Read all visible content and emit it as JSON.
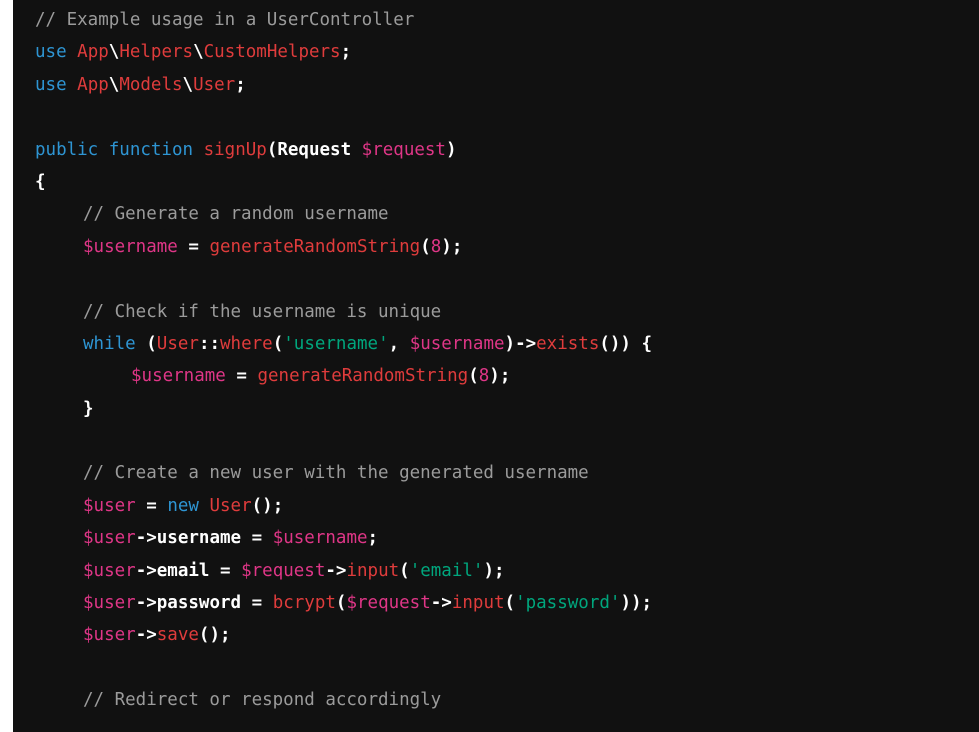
{
  "editor": {
    "language": "php",
    "theme": "dark",
    "background_color": "#111111",
    "gutter_color": "#ffffff",
    "colors": {
      "comment": "#9b9b9b",
      "keyword": "#2e95d3",
      "identifier": "#df3c3c",
      "variable": "#df3687",
      "number": "#df3687",
      "string": "#00a67d",
      "punctuation": "#ffffff",
      "property": "#ffffff"
    },
    "lines": [
      {
        "indent": 0,
        "tokens": [
          {
            "t": "comment",
            "v": "// Example usage in a UserController"
          }
        ]
      },
      {
        "indent": 0,
        "tokens": [
          {
            "t": "keyword",
            "v": "use"
          },
          {
            "t": "plain",
            "v": " "
          },
          {
            "t": "ident",
            "v": "App"
          },
          {
            "t": "punct",
            "v": "\\"
          },
          {
            "t": "ident",
            "v": "Helpers"
          },
          {
            "t": "punct",
            "v": "\\"
          },
          {
            "t": "ident",
            "v": "CustomHelpers"
          },
          {
            "t": "punct",
            "v": ";"
          }
        ]
      },
      {
        "indent": 0,
        "tokens": [
          {
            "t": "keyword",
            "v": "use"
          },
          {
            "t": "plain",
            "v": " "
          },
          {
            "t": "ident",
            "v": "App"
          },
          {
            "t": "punct",
            "v": "\\"
          },
          {
            "t": "ident",
            "v": "Models"
          },
          {
            "t": "punct",
            "v": "\\"
          },
          {
            "t": "ident",
            "v": "User"
          },
          {
            "t": "punct",
            "v": ";"
          }
        ]
      },
      {
        "indent": 0,
        "tokens": []
      },
      {
        "indent": 0,
        "tokens": [
          {
            "t": "keyword",
            "v": "public function"
          },
          {
            "t": "plain",
            "v": " "
          },
          {
            "t": "func",
            "v": "signUp"
          },
          {
            "t": "punct",
            "v": "("
          },
          {
            "t": "bold",
            "v": "Request"
          },
          {
            "t": "plain",
            "v": " "
          },
          {
            "t": "var",
            "v": "$request"
          },
          {
            "t": "punct",
            "v": ")"
          }
        ]
      },
      {
        "indent": 0,
        "tokens": [
          {
            "t": "punct",
            "v": "{"
          }
        ]
      },
      {
        "indent": 1,
        "tokens": [
          {
            "t": "comment",
            "v": "// Generate a random username"
          }
        ]
      },
      {
        "indent": 1,
        "tokens": [
          {
            "t": "var",
            "v": "$username"
          },
          {
            "t": "plain",
            "v": " "
          },
          {
            "t": "punct",
            "v": "="
          },
          {
            "t": "plain",
            "v": " "
          },
          {
            "t": "func",
            "v": "generateRandomString"
          },
          {
            "t": "punct",
            "v": "("
          },
          {
            "t": "number",
            "v": "8"
          },
          {
            "t": "punct",
            "v": ");"
          }
        ]
      },
      {
        "indent": 0,
        "tokens": []
      },
      {
        "indent": 1,
        "tokens": [
          {
            "t": "comment",
            "v": "// Check if the username is unique"
          }
        ]
      },
      {
        "indent": 1,
        "tokens": [
          {
            "t": "keyword",
            "v": "while"
          },
          {
            "t": "plain",
            "v": " "
          },
          {
            "t": "punct",
            "v": "("
          },
          {
            "t": "class",
            "v": "User"
          },
          {
            "t": "punct",
            "v": "::"
          },
          {
            "t": "func",
            "v": "where"
          },
          {
            "t": "punct",
            "v": "("
          },
          {
            "t": "string",
            "v": "'username'"
          },
          {
            "t": "punct",
            "v": ","
          },
          {
            "t": "plain",
            "v": " "
          },
          {
            "t": "var",
            "v": "$username"
          },
          {
            "t": "punct",
            "v": ")->"
          },
          {
            "t": "func",
            "v": "exists"
          },
          {
            "t": "punct",
            "v": "())"
          },
          {
            "t": "plain",
            "v": " "
          },
          {
            "t": "punct",
            "v": "{"
          }
        ]
      },
      {
        "indent": 2,
        "tokens": [
          {
            "t": "var",
            "v": "$username"
          },
          {
            "t": "plain",
            "v": " "
          },
          {
            "t": "punct",
            "v": "="
          },
          {
            "t": "plain",
            "v": " "
          },
          {
            "t": "func",
            "v": "generateRandomString"
          },
          {
            "t": "punct",
            "v": "("
          },
          {
            "t": "number",
            "v": "8"
          },
          {
            "t": "punct",
            "v": ");"
          }
        ]
      },
      {
        "indent": 1,
        "tokens": [
          {
            "t": "punct",
            "v": "}"
          }
        ]
      },
      {
        "indent": 0,
        "tokens": []
      },
      {
        "indent": 1,
        "tokens": [
          {
            "t": "comment",
            "v": "// Create a new user with the generated username"
          }
        ]
      },
      {
        "indent": 1,
        "tokens": [
          {
            "t": "var",
            "v": "$user"
          },
          {
            "t": "plain",
            "v": " "
          },
          {
            "t": "punct",
            "v": "="
          },
          {
            "t": "plain",
            "v": " "
          },
          {
            "t": "keyword",
            "v": "new"
          },
          {
            "t": "plain",
            "v": " "
          },
          {
            "t": "class",
            "v": "User"
          },
          {
            "t": "punct",
            "v": "();"
          }
        ]
      },
      {
        "indent": 1,
        "tokens": [
          {
            "t": "var",
            "v": "$user"
          },
          {
            "t": "punct",
            "v": "->"
          },
          {
            "t": "prop",
            "v": "username"
          },
          {
            "t": "plain",
            "v": " "
          },
          {
            "t": "punct",
            "v": "="
          },
          {
            "t": "plain",
            "v": " "
          },
          {
            "t": "var",
            "v": "$username"
          },
          {
            "t": "punct",
            "v": ";"
          }
        ]
      },
      {
        "indent": 1,
        "tokens": [
          {
            "t": "var",
            "v": "$user"
          },
          {
            "t": "punct",
            "v": "->"
          },
          {
            "t": "prop",
            "v": "email"
          },
          {
            "t": "plain",
            "v": " "
          },
          {
            "t": "punct",
            "v": "="
          },
          {
            "t": "plain",
            "v": " "
          },
          {
            "t": "var",
            "v": "$request"
          },
          {
            "t": "punct",
            "v": "->"
          },
          {
            "t": "func",
            "v": "input"
          },
          {
            "t": "punct",
            "v": "("
          },
          {
            "t": "string",
            "v": "'email'"
          },
          {
            "t": "punct",
            "v": ");"
          }
        ]
      },
      {
        "indent": 1,
        "tokens": [
          {
            "t": "var",
            "v": "$user"
          },
          {
            "t": "punct",
            "v": "->"
          },
          {
            "t": "prop",
            "v": "password"
          },
          {
            "t": "plain",
            "v": " "
          },
          {
            "t": "punct",
            "v": "="
          },
          {
            "t": "plain",
            "v": " "
          },
          {
            "t": "func",
            "v": "bcrypt"
          },
          {
            "t": "punct",
            "v": "("
          },
          {
            "t": "var",
            "v": "$request"
          },
          {
            "t": "punct",
            "v": "->"
          },
          {
            "t": "func",
            "v": "input"
          },
          {
            "t": "punct",
            "v": "("
          },
          {
            "t": "string",
            "v": "'password'"
          },
          {
            "t": "punct",
            "v": "));"
          }
        ]
      },
      {
        "indent": 1,
        "tokens": [
          {
            "t": "var",
            "v": "$user"
          },
          {
            "t": "punct",
            "v": "->"
          },
          {
            "t": "func",
            "v": "save"
          },
          {
            "t": "punct",
            "v": "();"
          }
        ]
      },
      {
        "indent": 0,
        "tokens": []
      },
      {
        "indent": 1,
        "tokens": [
          {
            "t": "comment",
            "v": "// Redirect or respond accordingly"
          }
        ]
      }
    ]
  }
}
